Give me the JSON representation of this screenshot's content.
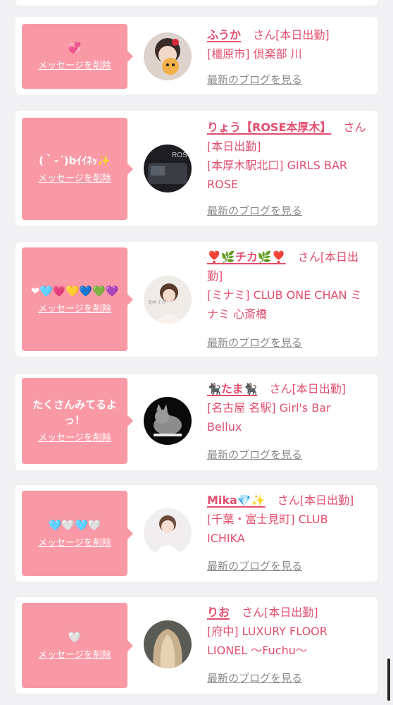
{
  "common": {
    "delete_label": "メッセージを削除",
    "blog_label": "最新のブログを見る",
    "san": "さん"
  },
  "colors": {
    "bubble": "#fa99a6",
    "accent": "#e14e6e",
    "link_gray": "#888888",
    "background": "#f1f1f3"
  },
  "cards": [
    {
      "message": "💞",
      "name": "ふうか",
      "status": "[本日出勤]",
      "shop": "[橿原市] 倶楽部 川"
    },
    {
      "message": "(｀-´)bｲｲﾈｯ✨",
      "name": "りょう【ROSE本厚木】",
      "status": "[本日出勤]",
      "shop": "[本厚木駅北口] GIRLS BAR ROSE"
    },
    {
      "message": "❤🩵💗💛💙💚💜",
      "name": "❣️🌿チカ🌿❣️",
      "status": "[本日出勤]",
      "shop": "[ミナミ] CLUB ONE CHAN ミナミ 心斎橋"
    },
    {
      "message": "たくさんみてるよっ！",
      "name": "🐈‍⬛たま🐈‍⬛",
      "status": "[本日出勤]",
      "shop": "[名古屋 名駅] Girl's Bar Bellux"
    },
    {
      "message": "🩵🤍🩵🤍",
      "name": "Mika💎✨",
      "status": "[本日出勤]",
      "shop": "[千葉・富士見町] CLUB ICHIKA"
    },
    {
      "message": "🤍",
      "name": "りお",
      "status": "[本日出勤]",
      "shop": "[府中] LUXURY FLOOR LIONEL 〜Fuchu〜"
    }
  ]
}
